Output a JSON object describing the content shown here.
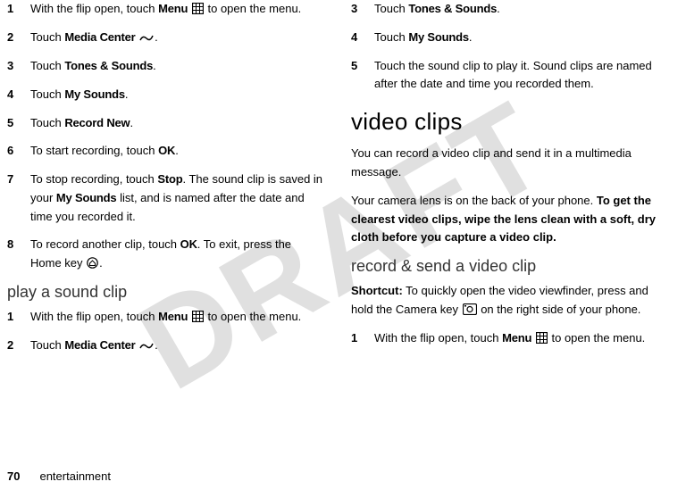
{
  "watermark": "DRAFT",
  "left": {
    "steps_a": [
      {
        "n": "1",
        "pre": "With the flip open, touch ",
        "b1": "Menu",
        "icon": "grid",
        "post": " to open the menu."
      },
      {
        "n": "2",
        "pre": "Touch ",
        "b1": "Media Center",
        "icon": "wave",
        "post": "."
      },
      {
        "n": "3",
        "pre": "Touch ",
        "b1": "Tones & Sounds",
        "post": "."
      },
      {
        "n": "4",
        "pre": "Touch ",
        "b1": "My Sounds",
        "post": "."
      },
      {
        "n": "5",
        "pre": "Touch ",
        "b1": "Record New",
        "post": "."
      },
      {
        "n": "6",
        "pre": "To start recording, touch ",
        "b1": "OK",
        "post": "."
      },
      {
        "n": "7",
        "pre": "To stop recording, touch ",
        "b1": "Stop",
        "post": ". The sound clip is saved in your ",
        "b2": "My Sounds",
        "post2": " list, and is named after the date and time you recorded it."
      },
      {
        "n": "8",
        "pre": "To record another clip, touch ",
        "b1": "OK",
        "post": ". To exit, press the Home key ",
        "icon2": "home",
        "post2": "."
      }
    ],
    "heading_play": "play a sound clip",
    "steps_b": [
      {
        "n": "1",
        "pre": "With the flip open, touch ",
        "b1": "Menu",
        "icon": "grid",
        "post": " to open the menu."
      },
      {
        "n": "2",
        "pre": "Touch ",
        "b1": "Media Center",
        "icon": "wave",
        "post": "."
      }
    ]
  },
  "right": {
    "steps_c": [
      {
        "n": "3",
        "pre": "Touch ",
        "b1": "Tones & Sounds",
        "post": "."
      },
      {
        "n": "4",
        "pre": "Touch ",
        "b1": "My Sounds",
        "post": "."
      },
      {
        "n": "5",
        "pre": "Touch the sound clip to play it. Sound clips are named after the date and time you recorded them."
      }
    ],
    "heading_video": "video clips",
    "para1": "You can record a video clip and send it in a multimedia message.",
    "para2_pre": "Your camera lens is on the back of your phone. ",
    "para2_bold": "To get the clearest video clips, wipe the lens clean with a soft, dry cloth before you capture a video clip.",
    "heading_record": "record & send a video clip",
    "shortcut_label": "Shortcut:",
    "shortcut_text_pre": " To quickly open the video viewfinder, press and hold the Camera key ",
    "shortcut_text_post": " on the right side of your phone.",
    "steps_d": [
      {
        "n": "1",
        "pre": "With the flip open, touch ",
        "b1": "Menu",
        "icon": "grid",
        "post": " to open the menu."
      }
    ]
  },
  "footer": {
    "page": "70",
    "section": "entertainment"
  }
}
